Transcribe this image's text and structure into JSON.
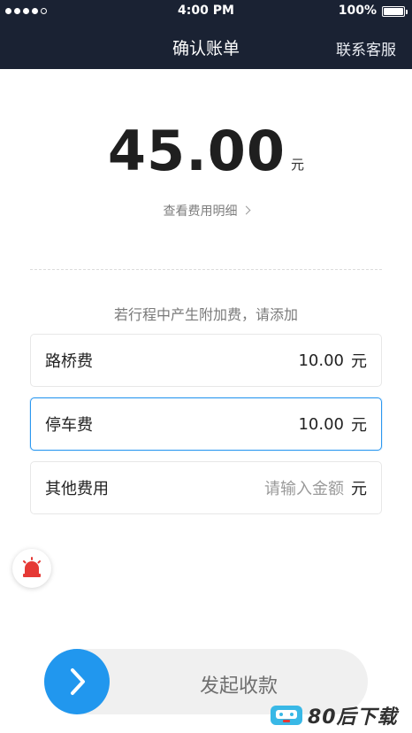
{
  "status_bar": {
    "time": "4:00 PM",
    "battery_text": "100%"
  },
  "nav": {
    "title": "确认账单",
    "contact": "联系客服"
  },
  "bill": {
    "amount": "45.00",
    "unit": "元",
    "detail_link": "查看费用明细"
  },
  "extra_hint": "若行程中产生附加费，请添加",
  "fees": [
    {
      "label": "路桥费",
      "value": "10.00",
      "unit": "元"
    },
    {
      "label": "停车费",
      "value": "10.00",
      "unit": "元"
    },
    {
      "label": "其他费用",
      "placeholder": "请输入金额",
      "unit": "元"
    }
  ],
  "slider": {
    "label": "发起收款"
  },
  "watermark": {
    "text": "80后下载"
  },
  "colors": {
    "header_bg": "#1a2233",
    "accent": "#2197ee",
    "alarm": "#e53935"
  },
  "icons": [
    "signal-dots-icon",
    "battery-icon",
    "chevron-right-icon",
    "alarm-icon",
    "arrow-right-icon",
    "watermark-logo-icon"
  ]
}
